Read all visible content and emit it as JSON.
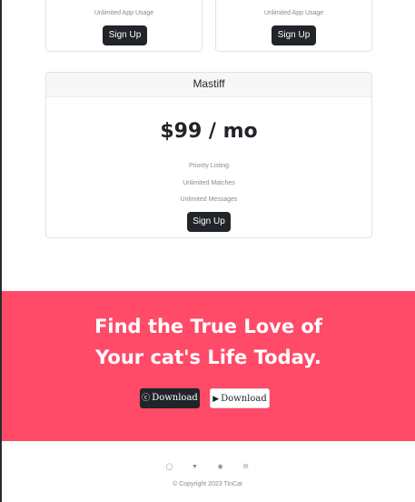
{
  "plans_top": [
    {
      "feature": "Unlimited App Usage",
      "button": "Sign Up"
    },
    {
      "feature": "Unlimited App Usage",
      "button": "Sign Up"
    }
  ],
  "plan_mastiff": {
    "title": "Mastiff",
    "price": "$99 / mo",
    "features": [
      "Priority Listing",
      "Unlimited Matches",
      "Unlimited Messages"
    ],
    "button": "Sign Up"
  },
  "cta": {
    "title_line1": "Find the True Love of",
    "title_line2": "Your cat's Life Today.",
    "download_dark_label": "Download",
    "download_light_label": "Download",
    "download_dark_icon": "apple-icon",
    "download_light_icon": "google-play-icon"
  },
  "footer": {
    "icons": [
      "instagram-icon",
      "twitter-icon",
      "facebook-icon",
      "email-icon"
    ],
    "copyright": "© Copyright 2023 TinCat"
  },
  "colors": {
    "accent": "#ff4a68",
    "dark": "#212529"
  }
}
